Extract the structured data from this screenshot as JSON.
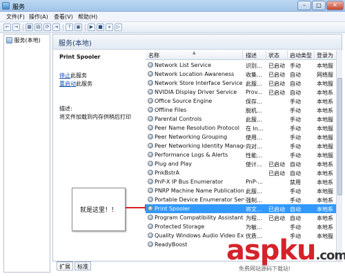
{
  "window": {
    "title": "服务"
  },
  "menu": [
    "文件(F)",
    "操作(A)",
    "查看(V)",
    "帮助(H)"
  ],
  "toolbar": {
    "buttons": [
      "←",
      "→",
      "▦",
      "▤",
      "⟳",
      "⇥",
      "?",
      "▣",
      "▶",
      "■",
      "⏸",
      "▷"
    ]
  },
  "tree": {
    "root": "服务(本地)"
  },
  "content": {
    "header": "服务(本地)"
  },
  "detail": {
    "service_name": "Print Spooler",
    "stop_link": "停止",
    "stop_suffix": "此服务",
    "restart_link": "重启动",
    "restart_suffix": "此服务",
    "desc_label": "描述:",
    "description": "将文件加载到内存供稍后打印"
  },
  "callout": {
    "text": "就是这里！！"
  },
  "list": {
    "columns": [
      "名称",
      "描述",
      "状态",
      "启动类型",
      "登录为"
    ],
    "rows": [
      {
        "name": "Network List Service",
        "desc": "识别...",
        "status": "已启动",
        "start": "手动",
        "logon": "本地服"
      },
      {
        "name": "Network Location Awareness",
        "desc": "收集...",
        "status": "已启动",
        "start": "自动",
        "logon": "网络服"
      },
      {
        "name": "Network Store Interface Service",
        "desc": "此服...",
        "status": "已启动",
        "start": "自动",
        "logon": "本地服"
      },
      {
        "name": "NVIDIA Display Driver Service",
        "desc": "Prov...",
        "status": "已启动",
        "start": "自动",
        "logon": "本地系"
      },
      {
        "name": "Office Source Engine",
        "desc": "保存...",
        "status": "",
        "start": "手动",
        "logon": "本地系"
      },
      {
        "name": "Offline Files",
        "desc": "脱机...",
        "status": "",
        "start": "手动",
        "logon": "本地系"
      },
      {
        "name": "Parental Controls",
        "desc": "此服...",
        "status": "",
        "start": "手动",
        "logon": "本地服"
      },
      {
        "name": "Peer Name Resolution Protocol",
        "desc": "在 In...",
        "status": "",
        "start": "手动",
        "logon": "本地服"
      },
      {
        "name": "Peer Networking Grouping",
        "desc": "使用...",
        "status": "",
        "start": "手动",
        "logon": "本地服"
      },
      {
        "name": "Peer Networking Identity Manager",
        "desc": "向对...",
        "status": "",
        "start": "手动",
        "logon": "本地服"
      },
      {
        "name": "Performance Logs & Alerts",
        "desc": "性能...",
        "status": "",
        "start": "手动",
        "logon": "本地服"
      },
      {
        "name": "Plug and Play",
        "desc": "使计...",
        "status": "已启动",
        "start": "自动",
        "logon": "本地系"
      },
      {
        "name": "PnkBstrA",
        "desc": "",
        "status": "已启动",
        "start": "自动",
        "logon": "本地系"
      },
      {
        "name": "PnP-X IP Bus Enumerator",
        "desc": "PnP-...",
        "status": "",
        "start": "禁用",
        "logon": "本地系"
      },
      {
        "name": "PNRP Machine Name Publication ...",
        "desc": "此服...",
        "status": "",
        "start": "手动",
        "logon": "本地服"
      },
      {
        "name": "Portable Device Enumerator Service",
        "desc": "强制...",
        "status": "",
        "start": "手动",
        "logon": "本地系"
      },
      {
        "name": "Print Spooler",
        "desc": "将文...",
        "status": "已启动",
        "start": "自动",
        "logon": "本地系"
      },
      {
        "name": "Program Compatibility Assistant S...",
        "desc": "为程...",
        "status": "已启动",
        "start": "自动",
        "logon": "本地系"
      },
      {
        "name": "Protected Storage",
        "desc": "为敏...",
        "status": "",
        "start": "手动",
        "logon": "本地系"
      },
      {
        "name": "Quality Windows Audio Video Exp...",
        "desc": "优质...",
        "status": "",
        "start": "手动",
        "logon": "本地服"
      },
      {
        "name": "ReadyBoost",
        "desc": "",
        "status": "",
        "start": "",
        "logon": ""
      }
    ],
    "selected_index": 16
  },
  "tabs": [
    "扩展",
    "标准"
  ],
  "watermark": {
    "brand": "aspku",
    "tld": ".com",
    "slogan": "免费网站源码下载站!"
  }
}
